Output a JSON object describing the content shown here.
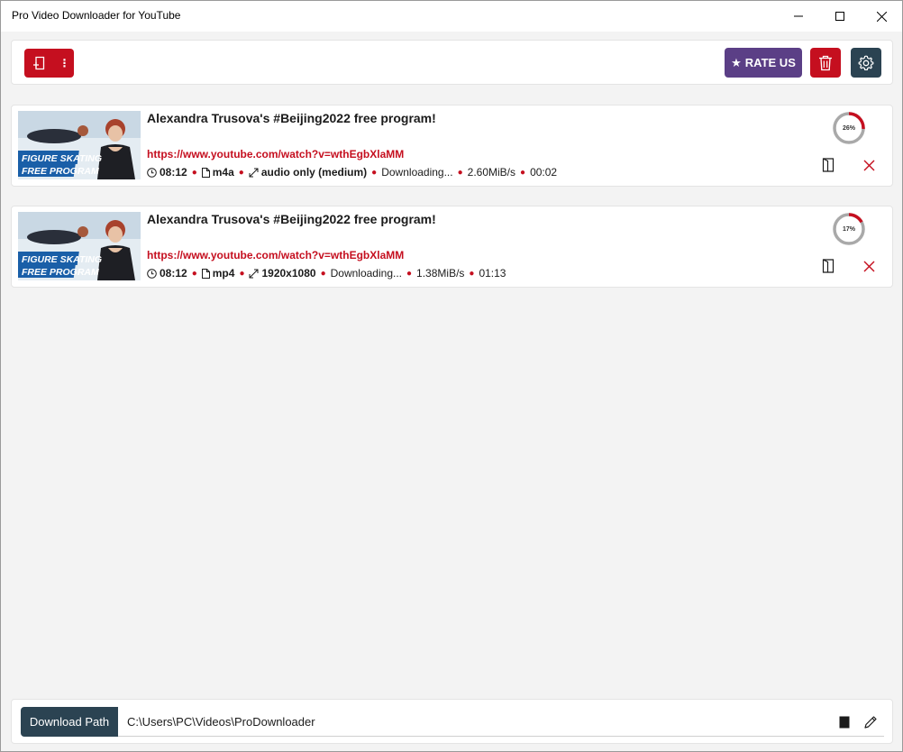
{
  "window": {
    "title": "Pro Video Downloader for YouTube"
  },
  "toolbar": {
    "rate_label": "RATE US",
    "rate_star": "★",
    "more_glyph": "⋮",
    "rate_color": "#5b3f86",
    "danger_color": "#c50f1f",
    "dark_color": "#2b4352"
  },
  "downloads": [
    {
      "title": "Alexandra Trusova's #Beijing2022 free program!",
      "url": "https://www.youtube.com/watch?v=wthEgbXlaMM",
      "duration": "08:12",
      "format": "m4a",
      "quality": "audio only (medium)",
      "status": "Downloading...",
      "speed": "2.60MiB/s",
      "eta": "00:02",
      "progress_label": "26%",
      "progress": 0.26,
      "thumb_text_1": "FIGURE SKATING",
      "thumb_text_2": "FREE PROGRAM"
    },
    {
      "title": "Alexandra Trusova's #Beijing2022 free program!",
      "url": "https://www.youtube.com/watch?v=wthEgbXlaMM",
      "duration": "08:12",
      "format": "mp4",
      "quality": "1920x1080",
      "status": "Downloading...",
      "speed": "1.38MiB/s",
      "eta": "01:13",
      "progress_label": "17%",
      "progress": 0.17,
      "thumb_text_1": "FIGURE SKATING",
      "thumb_text_2": "FREE PROGRAM"
    }
  ],
  "footer": {
    "path_label": "Download Path",
    "path_value": "C:\\Users\\PC\\Videos\\ProDownloader"
  }
}
